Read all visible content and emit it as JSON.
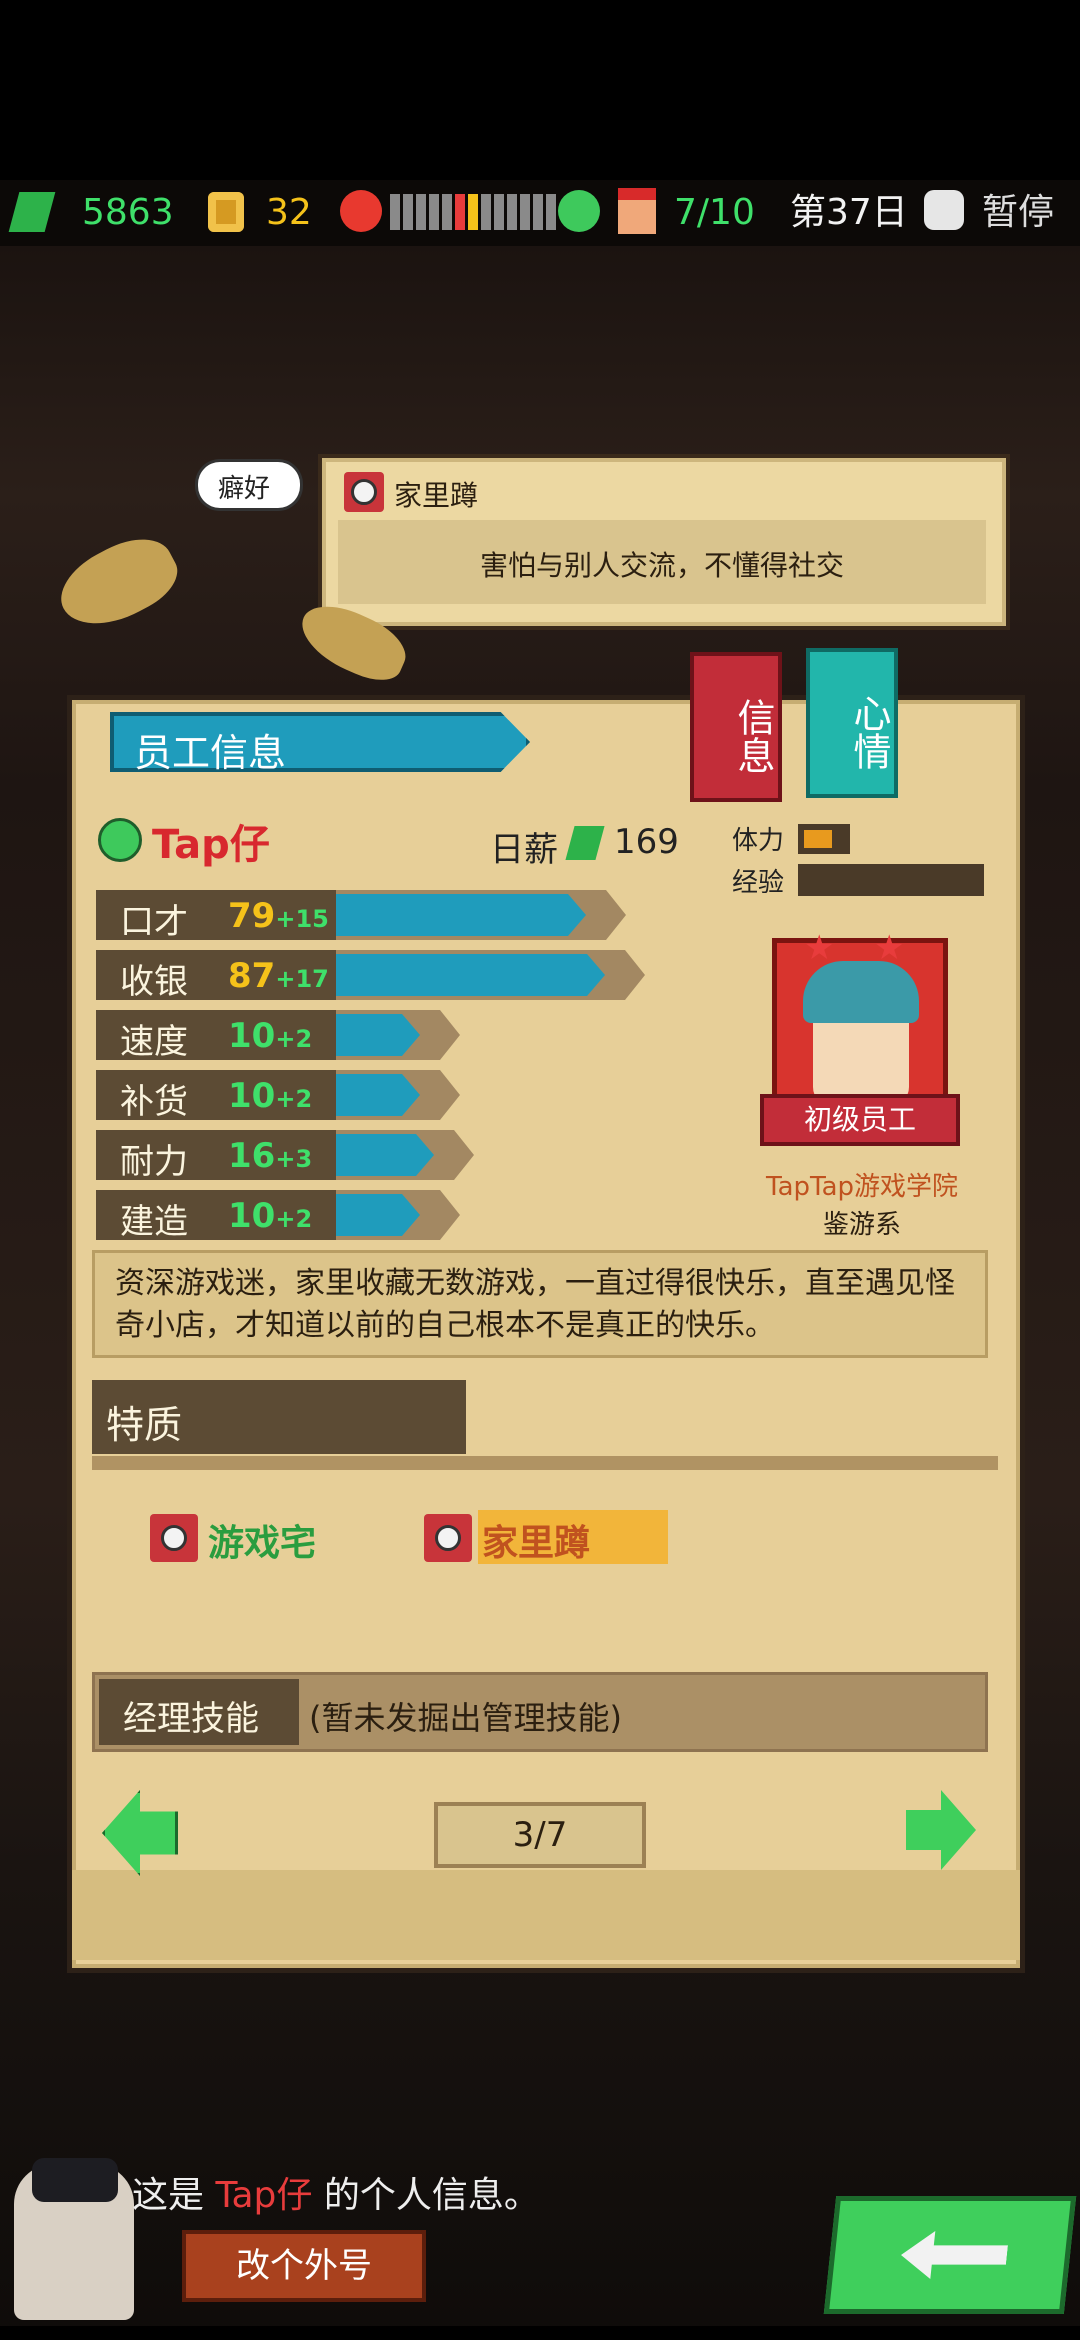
{
  "hud": {
    "money": "5863",
    "coins": "32",
    "mood_segments": [
      "#8a8a8a",
      "#8a8a8a",
      "#8a8a8a",
      "#8a8a8a",
      "#8a8a8a",
      "#e83c3c",
      "#f5c21a",
      "#8a8a8a",
      "#8a8a8a",
      "#8a8a8a",
      "#8a8a8a",
      "#8a8a8a",
      "#8a8a8a"
    ],
    "staff_count": "7/10",
    "day": "第37日",
    "pause_label": "暂停"
  },
  "tooltip": {
    "tag": "癖好",
    "trait_name": "家里蹲",
    "trait_desc": "害怕与别人交流，不懂得社交"
  },
  "panel": {
    "title": "员工信息",
    "tab_info": "信息",
    "tab_mood": "心情",
    "employee_name": "Tap仔",
    "salary_label": "日薪",
    "salary_value": "169",
    "stamina_label": "体力",
    "exp_label": "经验",
    "stats": [
      {
        "name": "口才",
        "value": "79",
        "bonus": "+15",
        "color": "#f5c21a",
        "fill": 0.79
      },
      {
        "name": "收银",
        "value": "87",
        "bonus": "+17",
        "color": "#f5c21a",
        "fill": 0.87
      },
      {
        "name": "速度",
        "value": "10",
        "bonus": "+2",
        "color": "#3fe06a",
        "fill": 0.1
      },
      {
        "name": "补货",
        "value": "10",
        "bonus": "+2",
        "color": "#3fe06a",
        "fill": 0.1
      },
      {
        "name": "耐力",
        "value": "16",
        "bonus": "+3",
        "color": "#3fe06a",
        "fill": 0.16
      },
      {
        "name": "建造",
        "value": "10",
        "bonus": "+2",
        "color": "#3fe06a",
        "fill": 0.1
      }
    ],
    "rank": "初级员工",
    "school": "TapTap游戏学院",
    "major": "鉴游系",
    "bio": "资深游戏迷，家里收藏无数游戏，一直过得很快乐，直至遇见怪奇小店，才知道以前的自己根本不是真正的快乐。",
    "traits_header": "特质",
    "traits": [
      "游戏宅",
      "家里蹲"
    ],
    "manager_label": "经理技能",
    "manager_value": "(暂未发掘出管理技能)",
    "page": "3/7"
  },
  "dialog": {
    "prefix": "这是",
    "name": "Tap仔",
    "suffix": "的个人信息。",
    "rename_button": "改个外号"
  }
}
